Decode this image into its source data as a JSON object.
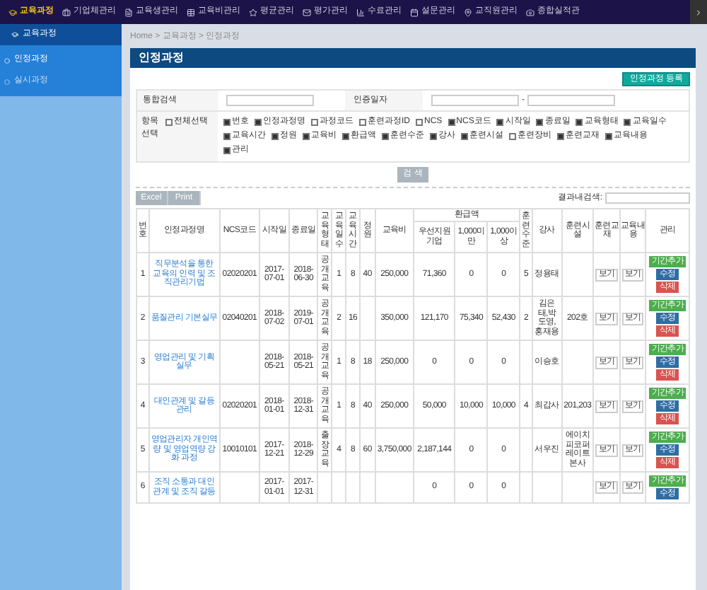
{
  "top_nav": [
    {
      "label": "교육과정",
      "selected": true
    },
    {
      "label": "기업체관리",
      "selected": false
    },
    {
      "label": "교육생관리",
      "selected": false
    },
    {
      "label": "교육비관리",
      "selected": false
    },
    {
      "label": "평균관리",
      "selected": false
    },
    {
      "label": "평가관리",
      "selected": false
    },
    {
      "label": "수료관리",
      "selected": false
    },
    {
      "label": "설문관리",
      "selected": false
    },
    {
      "label": "교직원관리",
      "selected": false
    },
    {
      "label": "종합실적관",
      "selected": false
    }
  ],
  "sidebar": {
    "title": "교육과정",
    "items": [
      {
        "label": "인정과정",
        "selected": true
      },
      {
        "label": "실시과정",
        "selected": false
      }
    ]
  },
  "breadcrumb": "Home > 교육과정 > 인정과정",
  "page_title": "인정과정",
  "register_button": "인정과정 등록",
  "search": {
    "keyword_label": "통합검색",
    "date_label": "인증일자",
    "date_separator": "-",
    "fields_label": "항목 선택",
    "select_all": {
      "label": "전체선택",
      "checked": false
    },
    "fields": [
      {
        "label": "번호",
        "checked": true
      },
      {
        "label": "인정과정명",
        "checked": true
      },
      {
        "label": "과정코드",
        "checked": false
      },
      {
        "label": "훈련과정ID",
        "checked": false
      },
      {
        "label": "NCS",
        "checked": false
      },
      {
        "label": "NCS코드",
        "checked": true
      },
      {
        "label": "시작일",
        "checked": true
      },
      {
        "label": "종료일",
        "checked": true
      },
      {
        "label": "교육형태",
        "checked": true
      },
      {
        "label": "교육일수",
        "checked": true
      },
      {
        "label": "교육시간",
        "checked": true
      },
      {
        "label": "정원",
        "checked": true
      },
      {
        "label": "교육비",
        "checked": true
      },
      {
        "label": "환급액",
        "checked": true
      },
      {
        "label": "훈련수준",
        "checked": true
      },
      {
        "label": "강사",
        "checked": true
      },
      {
        "label": "훈련시설",
        "checked": true
      },
      {
        "label": "훈련장비",
        "checked": false
      },
      {
        "label": "훈련교재",
        "checked": true
      },
      {
        "label": "교육내용",
        "checked": true
      },
      {
        "label": "관리",
        "checked": true
      }
    ],
    "search_button": "검 색"
  },
  "export_buttons": [
    "Excel",
    "Print"
  ],
  "result_search_label": "결과내검색:",
  "table": {
    "columns": [
      "번호",
      "인정과정명",
      "NCS코드",
      "시작일",
      "종료일",
      "교육형태",
      "교육일수",
      "교육시간",
      "정원",
      "교육비",
      "환급액",
      "훈련수준",
      "강사",
      "훈련시설",
      "훈련교재",
      "교육내용",
      "관리"
    ],
    "refund_subcolumns": [
      "우선지원기업",
      "1,000미만",
      "1,000이상"
    ],
    "rows": [
      {
        "no": "1",
        "name": "직무분석을 통한 교육의 인력 및 조직관리기법",
        "ncs": "02020201",
        "start": "2017-07-01",
        "end": "2018-06-30",
        "type": "공개교육",
        "days": "1",
        "hours": "8",
        "capacity": "40",
        "fee": "250,000",
        "refunds": [
          "71,360",
          "0",
          "0"
        ],
        "level": "5",
        "teacher": "정용태",
        "facility": "",
        "material": "보기",
        "content": "보기",
        "actions": [
          {
            "label": "기간추가",
            "kind": "add"
          },
          {
            "label": "수정",
            "kind": "edit"
          },
          {
            "label": "삭제",
            "kind": "delete"
          }
        ]
      },
      {
        "no": "2",
        "name": "품질관리 기본실무",
        "ncs": "02040201",
        "start": "2018-07-02",
        "end": "2019-07-01",
        "type": "공개교육",
        "days": "2",
        "hours": "16",
        "capacity": "",
        "fee": "350,000",
        "refunds": [
          "121,170",
          "75,340",
          "52,430"
        ],
        "level": "2",
        "teacher": "김은태,박도영,홍재용",
        "facility": "202호",
        "material": "보기",
        "content": "보기",
        "actions": [
          {
            "label": "기간추가",
            "kind": "add"
          },
          {
            "label": "수정",
            "kind": "edit"
          },
          {
            "label": "삭제",
            "kind": "delete"
          }
        ]
      },
      {
        "no": "3",
        "name": "영업관리 및 기획실무",
        "ncs": "",
        "start": "2018-05-21",
        "end": "2018-05-21",
        "type": "공개교육",
        "days": "1",
        "hours": "8",
        "capacity": "18",
        "fee": "250,000",
        "refunds": [
          "0",
          "0",
          "0"
        ],
        "level": "",
        "teacher": "이승호",
        "facility": "",
        "material": "보기",
        "content": "보기",
        "actions": [
          {
            "label": "기간추가",
            "kind": "add"
          },
          {
            "label": "수정",
            "kind": "edit"
          },
          {
            "label": "삭제",
            "kind": "delete"
          }
        ]
      },
      {
        "no": "4",
        "name": "대인관계 및 갈등관리",
        "ncs": "02020201",
        "start": "2018-01-01",
        "end": "2018-12-31",
        "type": "공개교육",
        "days": "1",
        "hours": "8",
        "capacity": "40",
        "fee": "250,000",
        "refunds": [
          "50,000",
          "10,000",
          "10,000"
        ],
        "level": "4",
        "teacher": "최갑사",
        "facility": "201,203",
        "material": "보기",
        "content": "보기",
        "actions": [
          {
            "label": "기간추가",
            "kind": "add"
          },
          {
            "label": "수정",
            "kind": "edit"
          },
          {
            "label": "삭제",
            "kind": "delete"
          }
        ]
      },
      {
        "no": "5",
        "name": "영업관리자 개인역량 및 영업역량 강화 과정",
        "ncs": "10010101",
        "start": "2017-12-21",
        "end": "2018-12-29",
        "type": "출장교육",
        "days": "4",
        "hours": "8",
        "capacity": "60",
        "fee": "3,750,000",
        "refunds": [
          "2,187,144",
          "0",
          "0"
        ],
        "level": "",
        "teacher": "서우진",
        "facility": "에이치피코퍼레이트본사",
        "material": "보기",
        "content": "보기",
        "actions": [
          {
            "label": "기간추가",
            "kind": "add"
          },
          {
            "label": "수정",
            "kind": "edit"
          },
          {
            "label": "삭제",
            "kind": "delete"
          }
        ]
      },
      {
        "no": "6",
        "name": "조직 소통과 대인관계 및 조직 갈등",
        "ncs": "",
        "start": "2017-01-01",
        "end": "2017-12-31",
        "type": "",
        "days": "",
        "hours": "",
        "capacity": "",
        "fee": "",
        "refunds": [
          "0",
          "0",
          "0"
        ],
        "level": "",
        "teacher": "",
        "facility": "",
        "material": "보기",
        "content": "보기",
        "actions": [
          {
            "label": "기간추가",
            "kind": "add"
          },
          {
            "label": "수정",
            "kind": "edit"
          }
        ]
      }
    ]
  }
}
